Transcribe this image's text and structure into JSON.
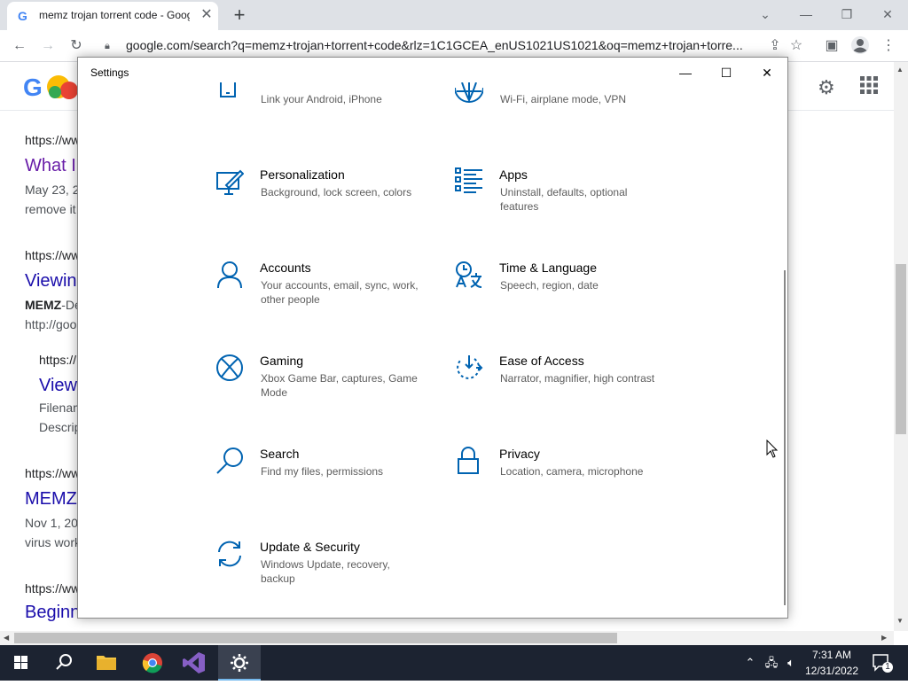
{
  "browser": {
    "tab_title": "memz trojan torrent code - Goog",
    "tab_favicon": "G",
    "url": "google.com/search?q=memz+trojan+torrent+code&rlz=1C1GCEA_enUS1021US1021&oq=memz+trojan+torre..."
  },
  "google_page": {
    "logo_text": "G",
    "results": [
      {
        "cite": "https://ww",
        "title": "What I",
        "snippet_1": "May 23, 2",
        "snippet_2": "remove it"
      },
      {
        "cite": "https://ww",
        "title": "Viewin",
        "snippet_1_bold": "MEMZ",
        "snippet_1": "-De",
        "snippet_2": "http://goo"
      },
      {
        "cite": "https://",
        "title": "View",
        "snippet_1": "Filenam",
        "snippet_2": "Descrip"
      },
      {
        "cite": "https://ww",
        "title": "MEMZ",
        "snippet_1": "Nov 1, 20",
        "snippet_2": "virus work"
      },
      {
        "cite": "https://ww",
        "title": "Beginn"
      }
    ]
  },
  "settings": {
    "window_title": "Settings",
    "tiles": [
      {
        "name": "",
        "desc": "Link your Android, iPhone",
        "icon": "phone-icon"
      },
      {
        "name": "",
        "desc": "Wi-Fi, airplane mode, VPN",
        "icon": "globe-icon"
      },
      {
        "name": "Personalization",
        "desc": "Background, lock screen, colors",
        "icon": "personalization-icon"
      },
      {
        "name": "Apps",
        "desc": "Uninstall, defaults, optional features",
        "icon": "apps-icon"
      },
      {
        "name": "Accounts",
        "desc": "Your accounts, email, sync, work, other people",
        "icon": "person-icon"
      },
      {
        "name": "Time & Language",
        "desc": "Speech, region, date",
        "icon": "time-language-icon"
      },
      {
        "name": "Gaming",
        "desc": "Xbox Game Bar, captures, Game Mode",
        "icon": "xbox-icon"
      },
      {
        "name": "Ease of Access",
        "desc": "Narrator, magnifier, high contrast",
        "icon": "ease-of-access-icon"
      },
      {
        "name": "Search",
        "desc": "Find my files, permissions",
        "icon": "search-icon"
      },
      {
        "name": "Privacy",
        "desc": "Location, camera, microphone",
        "icon": "lock-icon"
      },
      {
        "name": "Update & Security",
        "desc": "Windows Update, recovery, backup",
        "icon": "update-icon"
      }
    ]
  },
  "taskbar": {
    "time": "7:31 AM",
    "date": "12/31/2022",
    "notification_count": "1"
  },
  "colors": {
    "accent": "#0063b1",
    "taskbar": "#1c2331",
    "link": "#1a0dab"
  }
}
